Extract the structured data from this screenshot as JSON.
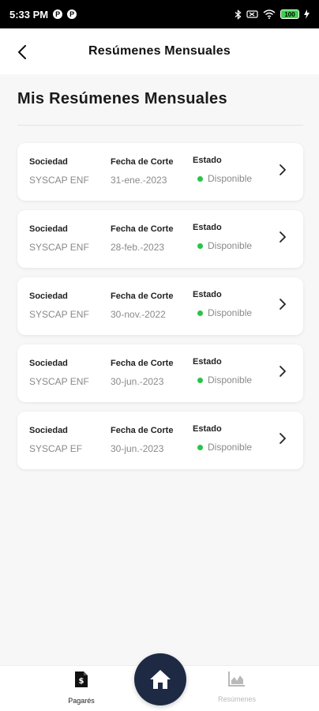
{
  "status_bar": {
    "time": "5:33 PM",
    "app_icons": [
      "P",
      "P"
    ],
    "battery": "100"
  },
  "header": {
    "title": "Resúmenes Mensuales"
  },
  "page": {
    "title": "Mis Resúmenes Mensuales"
  },
  "labels": {
    "sociedad": "Sociedad",
    "fecha": "Fecha de Corte",
    "estado": "Estado"
  },
  "cards": [
    {
      "sociedad": "SYSCAP ENF",
      "fecha": "31-ene.-2023",
      "estado": "Disponible"
    },
    {
      "sociedad": "SYSCAP ENF",
      "fecha": "28-feb.-2023",
      "estado": "Disponible"
    },
    {
      "sociedad": "SYSCAP ENF",
      "fecha": "30-nov.-2022",
      "estado": "Disponible"
    },
    {
      "sociedad": "SYSCAP ENF",
      "fecha": "30-jun.-2023",
      "estado": "Disponible"
    },
    {
      "sociedad": "SYSCAP EF",
      "fecha": "30-jun.-2023",
      "estado": "Disponible"
    }
  ],
  "bottom_nav": {
    "left_label": "Pagarés",
    "right_label": "Resúmenes"
  },
  "colors": {
    "status_available": "#27c449",
    "home_button": "#1e2a44"
  }
}
